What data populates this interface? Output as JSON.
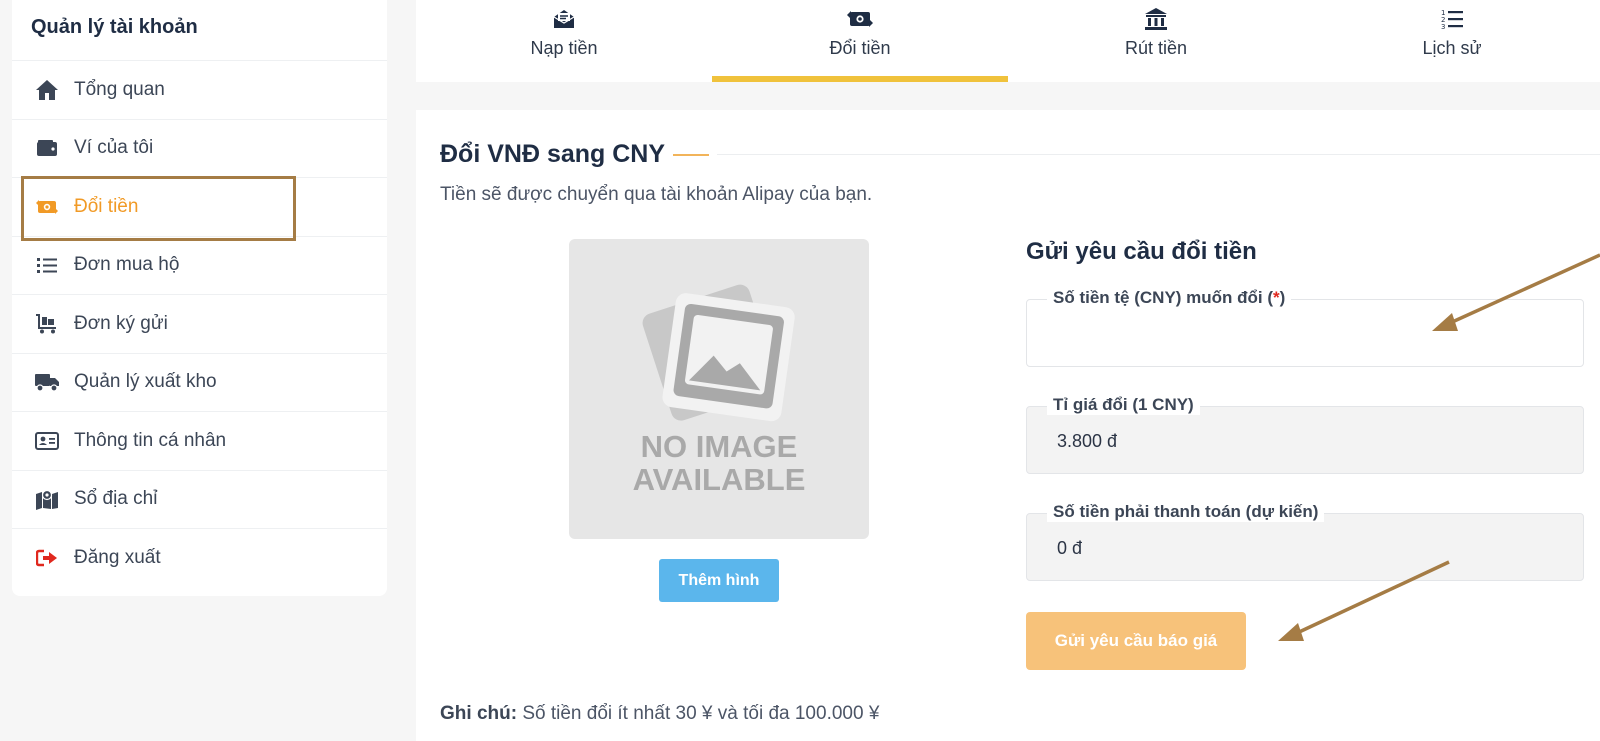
{
  "sidebar": {
    "title": "Quản lý tài khoản",
    "items": [
      {
        "label": "Tổng quan",
        "icon": "home-icon"
      },
      {
        "label": "Ví của tôi",
        "icon": "wallet-icon"
      },
      {
        "label": "Đổi tiền",
        "icon": "money-exchange-icon",
        "active": true
      },
      {
        "label": "Đơn mua hộ",
        "icon": "list-icon"
      },
      {
        "label": "Đơn ký gửi",
        "icon": "cart-icon"
      },
      {
        "label": "Quản lý xuất kho",
        "icon": "truck-icon"
      },
      {
        "label": "Thông tin cá nhân",
        "icon": "id-card-icon"
      },
      {
        "label": "Sổ địa chỉ",
        "icon": "map-icon"
      },
      {
        "label": "Đăng xuất",
        "icon": "logout-icon"
      }
    ]
  },
  "tabs": [
    {
      "label": "Nạp tiền",
      "icon": "deposit-icon"
    },
    {
      "label": "Đổi tiền",
      "icon": "exchange-icon",
      "active": true
    },
    {
      "label": "Rút tiền",
      "icon": "bank-icon"
    },
    {
      "label": "Lịch sử",
      "icon": "ordered-list-icon"
    }
  ],
  "main": {
    "title": "Đổi VNĐ sang CNY",
    "subtitle": "Tiền sẽ được chuyển qua tài khoản Alipay của bạn.",
    "image_placeholder": {
      "line1": "NO IMAGE",
      "line2": "AVAILABLE"
    },
    "add_image_label": "Thêm hình",
    "form": {
      "title": "Gửi yêu cầu đổi tiền",
      "amount_label": "Số tiền tệ (CNY) muốn đổi (",
      "amount_required": "*",
      "amount_label_end": ")",
      "amount_value": "",
      "rate_label": "Tỉ giá đổi (1 CNY)",
      "rate_value": "3.800 đ",
      "pay_label": "Số tiền phải thanh toán (dự kiến)",
      "pay_value": "0 đ",
      "submit_label": "Gửi yêu cầu báo giá"
    },
    "note_label": "Ghi chú:",
    "note_text": " Số tiền đổi ít nhất 30  ¥ và tối đa 100.000  ¥"
  },
  "colors": {
    "accent": "#f19a26",
    "tab_underline": "#f0c23c",
    "highlight_box": "#a57c45",
    "submit_bg": "#f7c27a",
    "add_image_bg": "#5bb6ec",
    "logout_icon": "#e0281e"
  }
}
